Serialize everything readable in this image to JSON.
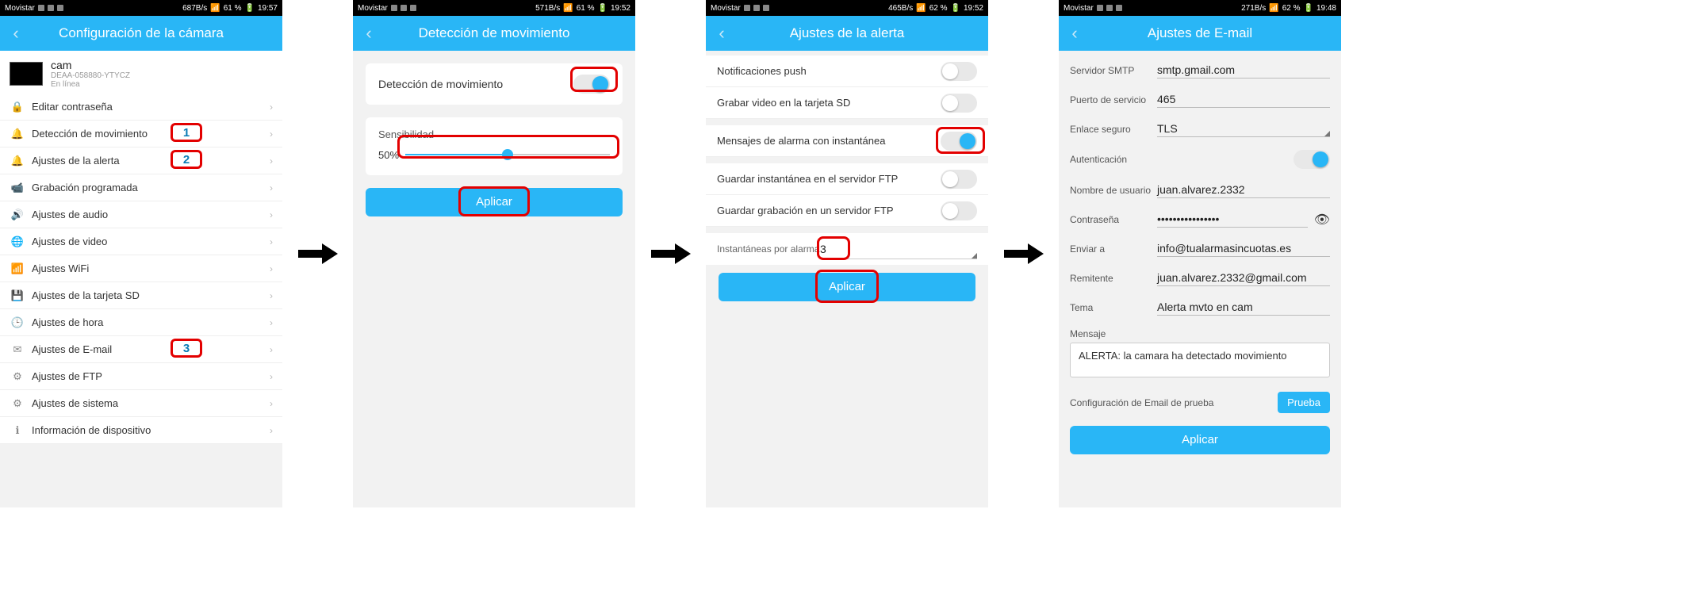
{
  "screens": {
    "s1": {
      "status": {
        "carrier": "Movistar",
        "net": "687B/s",
        "signal": "61 %",
        "time": "19:57"
      },
      "header": "Configuración de la cámara",
      "cam": {
        "name": "cam",
        "id": "DEAA-058880-YTYCZ",
        "state": "En línea"
      },
      "items": [
        {
          "icon": "🔒",
          "label": "Editar contraseña"
        },
        {
          "icon": "🔔",
          "label": "Detección de movimiento",
          "badge": "1"
        },
        {
          "icon": "🔔",
          "label": "Ajustes de la alerta",
          "badge": "2"
        },
        {
          "icon": "📹",
          "label": "Grabación programada"
        },
        {
          "icon": "🔊",
          "label": "Ajustes de audio"
        },
        {
          "icon": "🌐",
          "label": "Ajustes de video"
        },
        {
          "icon": "📶",
          "label": "Ajustes WiFi"
        },
        {
          "icon": "💾",
          "label": "Ajustes de la tarjeta SD"
        },
        {
          "icon": "🕒",
          "label": "Ajustes de hora"
        },
        {
          "icon": "✉",
          "label": "Ajustes de E-mail",
          "badge": "3"
        },
        {
          "icon": "⚙",
          "label": "Ajustes de FTP"
        },
        {
          "icon": "⚙",
          "label": "Ajustes de sistema"
        },
        {
          "icon": "ℹ",
          "label": "Información de dispositivo"
        }
      ]
    },
    "s2": {
      "status": {
        "carrier": "Movistar",
        "net": "571B/s",
        "signal": "61 %",
        "time": "19:52"
      },
      "header": "Detección de movimiento",
      "toggle_label": "Detección de movimiento",
      "sens_label": "Sensibilidad",
      "sens_value": "50%",
      "apply": "Aplicar"
    },
    "s3": {
      "status": {
        "carrier": "Movistar",
        "net": "465B/s",
        "signal": "62 %",
        "time": "19:52"
      },
      "header": "Ajustes de la alerta",
      "rows": [
        {
          "label": "Notificaciones push",
          "on": false
        },
        {
          "label": "Grabar video en la tarjeta SD",
          "on": false
        },
        {
          "label": "Mensajes de alarma con instantánea",
          "on": true
        },
        {
          "label": "Guardar instantánea en el servidor FTP",
          "on": false
        },
        {
          "label": "Guardar grabación en un servidor FTP",
          "on": false
        }
      ],
      "snapshots_label": "Instantáneas por alarma",
      "snapshots_value": "3",
      "apply": "Aplicar"
    },
    "s4": {
      "status": {
        "carrier": "Movistar",
        "net": "271B/s",
        "signal": "62 %",
        "time": "19:48"
      },
      "header": "Ajustes de E-mail",
      "fields": {
        "smtp_l": "Servidor SMTP",
        "smtp_v": "smtp.gmail.com",
        "port_l": "Puerto de servicio",
        "port_v": "465",
        "sec_l": "Enlace seguro",
        "sec_v": "TLS",
        "auth_l": "Autenticación",
        "user_l": "Nombre de usuario",
        "user_v": "juan.alvarez.2332",
        "pass_l": "Contraseña",
        "pass_v": "••••••••••••••••",
        "to_l": "Enviar a",
        "to_v": "info@tualarmasincuotas.es",
        "from_l": "Remitente",
        "from_v": "juan.alvarez.2332@gmail.com",
        "subj_l": "Tema",
        "subj_v": "Alerta mvto en cam",
        "msg_l": "Mensaje",
        "msg_v": "ALERTA: la camara ha detectado movimiento",
        "test_l": "Configuración de Email de prueba",
        "test_btn": "Prueba",
        "apply": "Aplicar"
      }
    }
  }
}
